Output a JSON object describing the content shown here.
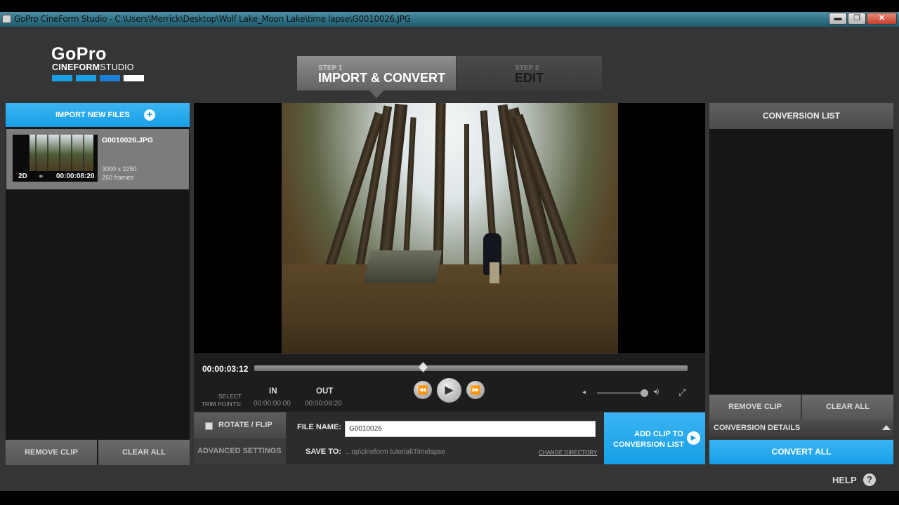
{
  "window": {
    "title": "GoPro CineForm Studio - C:\\Users\\Merrick\\Desktop\\Wolf Lake_Moon Lake\\time lapse\\G0010026.JPG",
    "minimize": "▬",
    "maximize": "❐",
    "close": "✕"
  },
  "logo": {
    "brand": "GoPro",
    "product_bold": "CINEFORM",
    "product_light": "STUDIO",
    "bar_colors": [
      "#1aa0e7",
      "#1aa0e7",
      "#1a7fd6",
      "#ffffff"
    ]
  },
  "steps": [
    {
      "num": "STEP 1",
      "name": "IMPORT & CONVERT",
      "active": true
    },
    {
      "num": "STEP 2",
      "name": "EDIT",
      "active": false
    }
  ],
  "left_panel": {
    "import_label": "IMPORT NEW FILES",
    "import_icon": "plus-circle-icon",
    "clips": [
      {
        "badge": "2D",
        "duration": "00:00:08:20",
        "name": "G0010026.JPG",
        "resolution": "3000 x 2250",
        "frames": "260 frames"
      }
    ],
    "remove_clip": "REMOVE CLIP",
    "clear_all": "CLEAR ALL"
  },
  "player": {
    "timecode": "00:00:03:12",
    "scrub_position": 0.39,
    "select_trim_1": "SELECT",
    "select_trim_2": "TRIM POINTS:",
    "in_label": "IN",
    "in_value": "00:00:00:00",
    "out_label": "OUT",
    "out_value": "00:00:08:20",
    "rewind_icon": "⏪",
    "play_icon": "▶",
    "forward_icon": "⏩",
    "volume_low_icon": "🔈",
    "volume_high_icon": "🔊",
    "volume_level": 0.9,
    "fullscreen_icon": "⤢"
  },
  "settings": {
    "rotate_flip": "ROTATE / FLIP",
    "advanced": "ADVANCED SETTINGS",
    "file_name_label": "FILE NAME:",
    "file_name_value": "G0010026",
    "save_to_label": "SAVE TO:",
    "save_to_value": "...op\\cineform tutorial\\Timelapse",
    "change_directory": "CHANGE DIRECTORY",
    "add_clip_line1": "ADD CLIP TO",
    "add_clip_line2": "CONVERSION LIST",
    "add_clip_icon": "▶"
  },
  "right_panel": {
    "header": "CONVERSION LIST",
    "remove_clip": "REMOVE CLIP",
    "clear_all": "CLEAR ALL",
    "details": "CONVERSION DETAILS",
    "convert_all": "CONVERT ALL"
  },
  "footer": {
    "help": "HELP",
    "help_icon": "?"
  },
  "colors": {
    "accent": "#1aa0e7",
    "background": "#353535",
    "panel": "#161616"
  }
}
